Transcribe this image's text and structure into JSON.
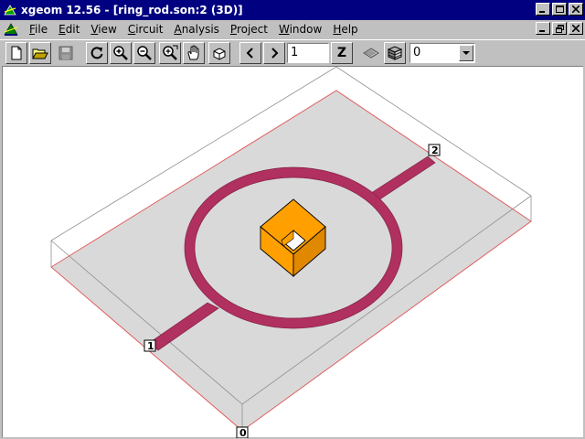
{
  "window": {
    "title": "xgeom 12.56 - [ring_rod.son:2 (3D)]"
  },
  "menubar": {
    "items": [
      {
        "label": "File",
        "key": "F",
        "rest": "ile"
      },
      {
        "label": "Edit",
        "key": "E",
        "rest": "dit"
      },
      {
        "label": "View",
        "key": "V",
        "rest": "iew"
      },
      {
        "label": "Circuit",
        "key": "C",
        "rest": "ircuit"
      },
      {
        "label": "Analysis",
        "key": "A",
        "rest": "nalysis"
      },
      {
        "label": "Project",
        "key": "P",
        "rest": "roject"
      },
      {
        "label": "Window",
        "key": "W",
        "rest": "indow"
      },
      {
        "label": "Help",
        "key": "H",
        "rest": "elp"
      }
    ]
  },
  "toolbar": {
    "level_value": "1",
    "z_label": "Z",
    "layer_value": "0",
    "icons": [
      "new-file-icon",
      "open-folder-icon",
      "save-disabled-icon",
      "rotate-icon",
      "zoom-in-icon",
      "zoom-out-icon",
      "zoom-fit-icon",
      "pan-hand-icon",
      "3d-box-icon",
      "prev-level-icon",
      "next-level-icon",
      "z-view-icon",
      "mesh-icon",
      "layers-icon"
    ]
  },
  "viewport": {
    "port_labels": [
      "1",
      "2",
      "0"
    ],
    "colors": {
      "substrate": "#d9d9d9",
      "box_edge_red": "#e06060",
      "ring": "#b03060",
      "via_front": "#ffa000",
      "via_dark": "#e08800"
    }
  }
}
